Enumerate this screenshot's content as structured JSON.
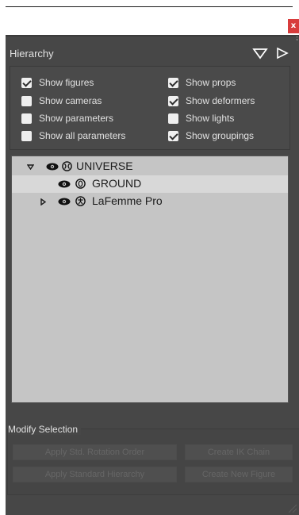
{
  "window": {
    "close_glyph": "x",
    "title": "Hierarchy",
    "menu_icon": "triangle-down-outline-icon",
    "play_icon": "triangle-right-outline-icon",
    "corner_glyph": "⁏"
  },
  "options": [
    {
      "label": "Show figures",
      "checked": true
    },
    {
      "label": "Show props",
      "checked": true
    },
    {
      "label": "Show cameras",
      "checked": false
    },
    {
      "label": "Show deformers",
      "checked": true
    },
    {
      "label": "Show parameters",
      "checked": false
    },
    {
      "label": "Show lights",
      "checked": false
    },
    {
      "label": "Show all parameters",
      "checked": false
    },
    {
      "label": "Show groupings",
      "checked": true
    }
  ],
  "tree": {
    "items": [
      {
        "label": "UNIVERSE",
        "expanded": true,
        "visible": true,
        "icon": "universe-icon",
        "selected": false
      },
      {
        "label": "GROUND",
        "expanded": false,
        "visible": true,
        "icon": "ground-icon",
        "selected": true
      },
      {
        "label": "LaFemme Pro",
        "expanded": false,
        "visible": true,
        "icon": "figure-icon",
        "selected": false
      }
    ]
  },
  "modify": {
    "title": "Modify Selection",
    "buttons": [
      {
        "label": "Apply Std. Rotation Order",
        "enabled": false
      },
      {
        "label": "Create IK Chain",
        "enabled": false
      },
      {
        "label": "Apply Standard Hierarchy",
        "enabled": false
      },
      {
        "label": "Create New Figure",
        "enabled": false
      }
    ]
  },
  "colors": {
    "panel_bg": "#474747",
    "tree_bg": "#c5c5c5",
    "close_bg": "#d83c3c",
    "disabled_text": "#666666"
  }
}
